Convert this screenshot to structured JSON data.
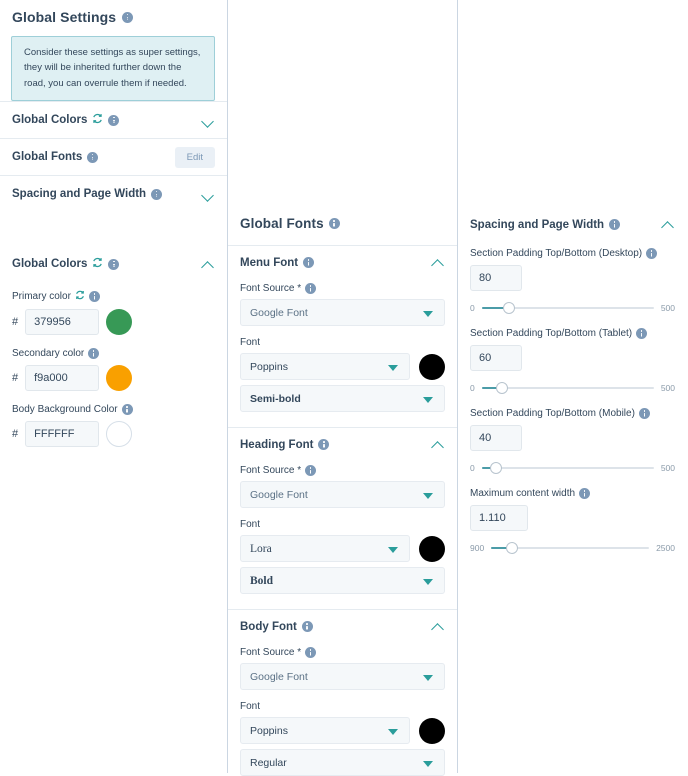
{
  "left": {
    "page_title": "Global Settings",
    "notice": "Consider these settings as super settings, they will be inherited further down the road, you can overrule them if needed.",
    "rows": [
      {
        "label": "Global Colors"
      },
      {
        "label": "Global Fonts",
        "button": "Edit"
      },
      {
        "label": "Spacing and Page Width"
      }
    ],
    "colors_panel": {
      "title": "Global Colors",
      "hash": "#",
      "fields": [
        {
          "label": "Primary color",
          "value": "379956",
          "swatch": "#379956"
        },
        {
          "label": "Secondary color",
          "value": "f9a000",
          "swatch": "#f9a000"
        },
        {
          "label": "Body Background Color",
          "value": "FFFFFF",
          "swatch": "#FFFFFF"
        }
      ]
    }
  },
  "middle": {
    "title": "Global Fonts",
    "source_label": "Font Source *",
    "font_label": "Font",
    "sections": [
      {
        "title": "Menu Font",
        "source": "Google Font",
        "font": "Poppins",
        "weight": "Semi-bold",
        "swatch": "#000000"
      },
      {
        "title": "Heading Font",
        "source": "Google Font",
        "font": "Lora",
        "weight": "Bold",
        "swatch": "#000000"
      },
      {
        "title": "Body Font",
        "source": "Google Font",
        "font": "Poppins",
        "weight": "Regular",
        "swatch": "#000000"
      }
    ]
  },
  "right": {
    "title": "Spacing and Page Width",
    "fields": [
      {
        "label": "Section Padding Top/Bottom (Desktop)",
        "value": "80",
        "min": "0",
        "max": "500",
        "pct": 16
      },
      {
        "label": "Section Padding Top/Bottom (Tablet)",
        "value": "60",
        "min": "0",
        "max": "500",
        "pct": 12
      },
      {
        "label": "Section Padding Top/Bottom (Mobile)",
        "value": "40",
        "min": "0",
        "max": "500",
        "pct": 8
      },
      {
        "label": "Maximum content width",
        "value": "1.110",
        "min": "900",
        "max": "2500",
        "pct": 13
      }
    ]
  }
}
